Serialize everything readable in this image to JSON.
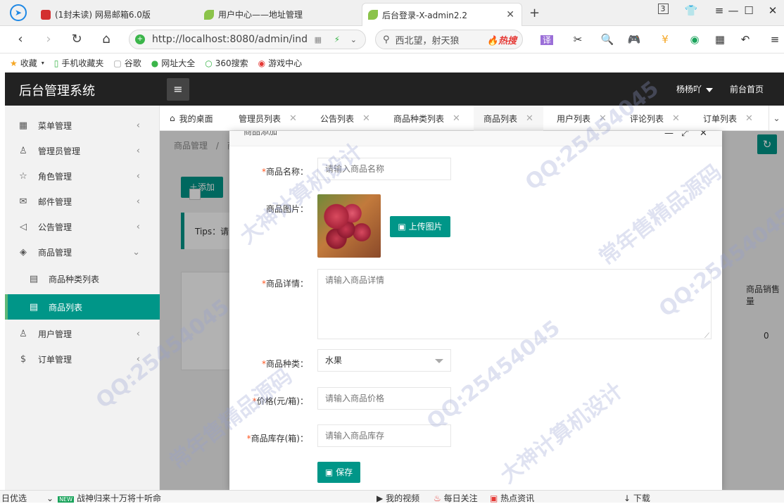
{
  "browser": {
    "tabs": [
      {
        "label": "(1封未读) 网易邮箱6.0版",
        "icon": "netease-mail-icon",
        "color": "#d32f2f"
      },
      {
        "label": "用户中心——地址管理",
        "icon": "leaf-icon",
        "color": "#8bc34a"
      },
      {
        "label": "后台登录-X-admin2.2",
        "icon": "leaf-icon",
        "color": "#8bc34a"
      }
    ],
    "tab_count": "3",
    "url": "http://localhost:8080/admin/ind",
    "search_text": "西北望，射天狼",
    "search_badge": "热搜",
    "translate_label": "译",
    "bookmarks": [
      {
        "label": "收藏",
        "icon": "star-icon"
      },
      {
        "label": "手机收藏夹",
        "icon": "phone-icon"
      },
      {
        "label": "谷歌",
        "icon": "page-icon"
      },
      {
        "label": "网址大全",
        "icon": "globe-icon"
      },
      {
        "label": "360搜索",
        "icon": "search-360-icon"
      },
      {
        "label": "游戏中心",
        "icon": "game-icon"
      }
    ]
  },
  "app": {
    "title": "后台管理系统",
    "user": "杨杨吖",
    "front_link": "前台首页",
    "accent": "#009688"
  },
  "sidebar": {
    "items": [
      {
        "label": "菜单管理",
        "icon": "grid-icon"
      },
      {
        "label": "管理员管理",
        "icon": "user-icon"
      },
      {
        "label": "角色管理",
        "icon": "star-outline-icon"
      },
      {
        "label": "邮件管理",
        "icon": "mail-icon"
      },
      {
        "label": "公告管理",
        "icon": "speaker-icon"
      },
      {
        "label": "商品管理",
        "icon": "cube-icon"
      },
      {
        "label": "商品种类列表",
        "icon": "doc-icon"
      },
      {
        "label": "商品列表",
        "icon": "doc-icon"
      },
      {
        "label": "用户管理",
        "icon": "user-icon"
      },
      {
        "label": "订单管理",
        "icon": "dollar-icon"
      }
    ]
  },
  "page_tabs": [
    {
      "label": "我的桌面"
    },
    {
      "label": "管理员列表"
    },
    {
      "label": "公告列表"
    },
    {
      "label": "商品种类列表"
    },
    {
      "label": "商品列表"
    },
    {
      "label": "用户列表"
    },
    {
      "label": "评论列表"
    },
    {
      "label": "订单列表"
    }
  ],
  "content": {
    "breadcrumb_root": "商品管理",
    "breadcrumb_sep": "/",
    "breadcrumb_current": "商",
    "add_label": "添加",
    "tips_label": "Tips：请",
    "sales_column": "商品销售量",
    "sales_value": "0"
  },
  "modal": {
    "title": "商品添加",
    "fields": {
      "name": {
        "label": "商品名称：",
        "placeholder": "请输入商品名称"
      },
      "image": {
        "label": "商品图片：",
        "upload_label": "上传图片"
      },
      "detail": {
        "label": "商品详情：",
        "placeholder": "请输入商品详情"
      },
      "category": {
        "label": "商品种类：",
        "value": "水果"
      },
      "price": {
        "label": "价格(元/箱)：",
        "placeholder": "请输入商品价格"
      },
      "stock": {
        "label": "商品库存(箱)：",
        "placeholder": "请输入商品库存"
      }
    },
    "save_label": "保存"
  },
  "statusbar": {
    "left": "日优选",
    "news": "战神归来十万将十听命",
    "news_tag": "NEW",
    "items": [
      "我的视频",
      "每日关注",
      "热点资讯",
      "下载"
    ]
  },
  "watermark": {
    "texts": [
      "QQ:25454045",
      "常年售精品源码",
      "大神计算机设计"
    ]
  }
}
